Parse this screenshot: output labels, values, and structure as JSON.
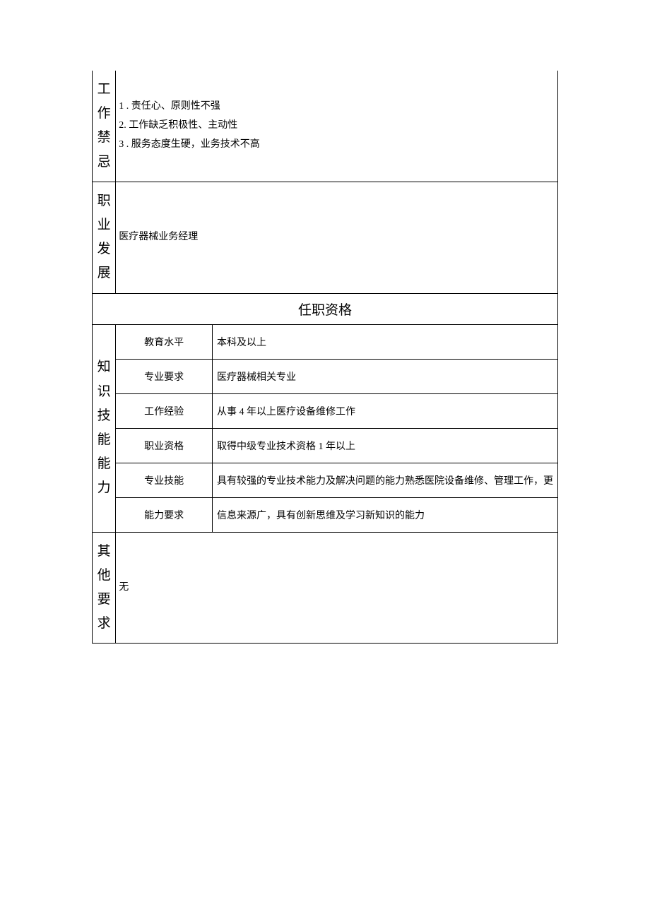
{
  "sections": {
    "taboos": {
      "label": "工作禁忌",
      "items": [
        "1        . 责任心、原则性不强",
        "2. 工作缺乏积极性、主动性",
        "3        . 服务态度生硬，业务技术不高"
      ]
    },
    "career": {
      "label": "职业发展",
      "value": "医疗器械业务经理"
    },
    "qualifications_header": "任职资格",
    "knowledge": {
      "label": "知识技能能力",
      "rows": [
        {
          "k": "教育水平",
          "v": "本科及以上"
        },
        {
          "k": "专业要求",
          "v": "医疗器械相关专业"
        },
        {
          "k": "工作经验",
          "v": "从事 4 年以上医疗设备维修工作"
        },
        {
          "k": "职业资格",
          "v": "取得中级专业技术资格 1 年以上"
        },
        {
          "k": "专业技能",
          "v": "具有较强的专业技术能力及解决问题的能力熟悉医院设备维修、管理工作，更"
        },
        {
          "k": "能力要求",
          "v": "信息来源广，具有创新思维及学习新知识的能力"
        }
      ]
    },
    "other": {
      "label": "其他要求",
      "value": "无"
    }
  }
}
